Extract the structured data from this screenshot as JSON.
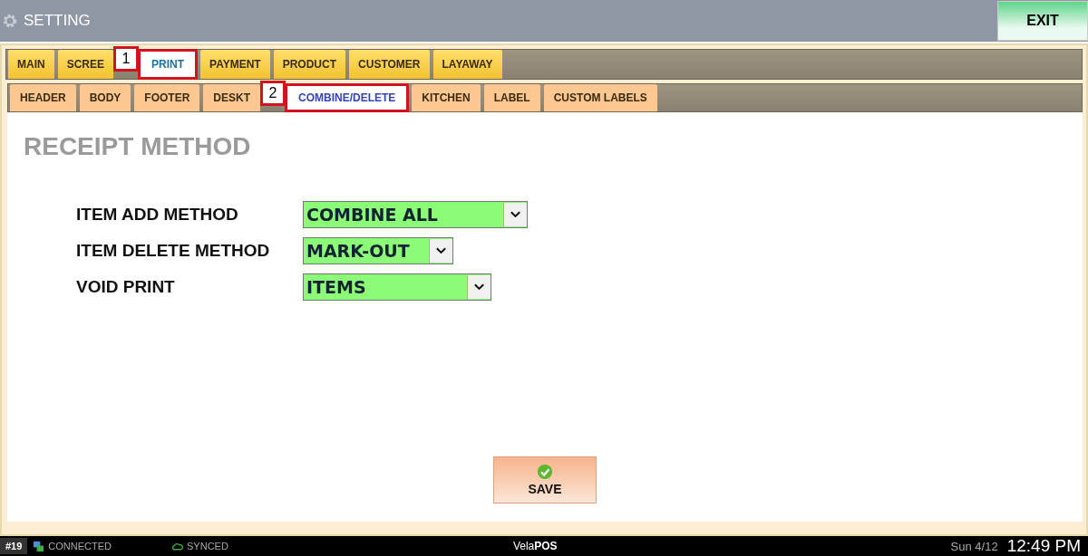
{
  "window": {
    "title": "SETTING",
    "exit_button": "EXIT"
  },
  "tabs": [
    {
      "label": "MAIN",
      "selected": false
    },
    {
      "label": "SCREE",
      "selected": false
    },
    {
      "label": "PRINT",
      "selected": true,
      "callout": "1"
    },
    {
      "label": "PAYMENT",
      "selected": false
    },
    {
      "label": "PRODUCT",
      "selected": false
    },
    {
      "label": "CUSTOMER",
      "selected": false
    },
    {
      "label": "LAYAWAY",
      "selected": false
    }
  ],
  "subtabs": [
    {
      "label": "HEADER",
      "selected": false
    },
    {
      "label": "BODY",
      "selected": false
    },
    {
      "label": "FOOTER",
      "selected": false
    },
    {
      "label": "DESKT",
      "selected": false
    },
    {
      "label": "COMBINE/DELETE",
      "selected": true,
      "callout": "2"
    },
    {
      "label": "KITCHEN",
      "selected": false
    },
    {
      "label": "LABEL",
      "selected": false
    },
    {
      "label": "CUSTOM LABELS",
      "selected": false
    }
  ],
  "section_title": "RECEIPT METHOD",
  "settings": [
    {
      "label": "ITEM ADD METHOD",
      "value": "COMBINE ALL"
    },
    {
      "label": "ITEM DELETE METHOD",
      "value": "MARK-OUT"
    },
    {
      "label": "VOID PRINT",
      "value": "ITEMS"
    }
  ],
  "save_button": "SAVE",
  "status_bar": {
    "station": "#19",
    "connection": "CONNECTED",
    "sync": "SYNCED",
    "brand": "Vela**POS**",
    "date": "Sun 4/12",
    "time": "12:49 PM"
  }
}
